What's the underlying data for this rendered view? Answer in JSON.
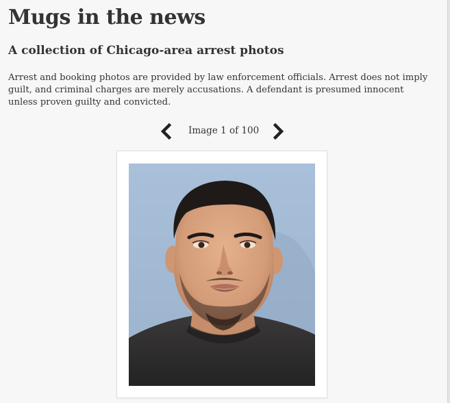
{
  "header": {
    "title": "Mugs in the news",
    "subtitle": "A collection of Chicago-area arrest photos"
  },
  "disclaimer": "Arrest and booking photos are provided by law enforcement officials. Arrest does not imply guilt, and criminal charges are merely accusations. A defendant is presumed innocent unless proven guilty and convicted.",
  "gallery": {
    "counter": "Image 1 of 100",
    "prev_icon": "chevron-left-icon",
    "next_icon": "chevron-right-icon",
    "current_photo": "booking-photo"
  },
  "colors": {
    "background": "#f7f7f7",
    "text": "#333333",
    "photo_backdrop": "#a6bcd6"
  }
}
